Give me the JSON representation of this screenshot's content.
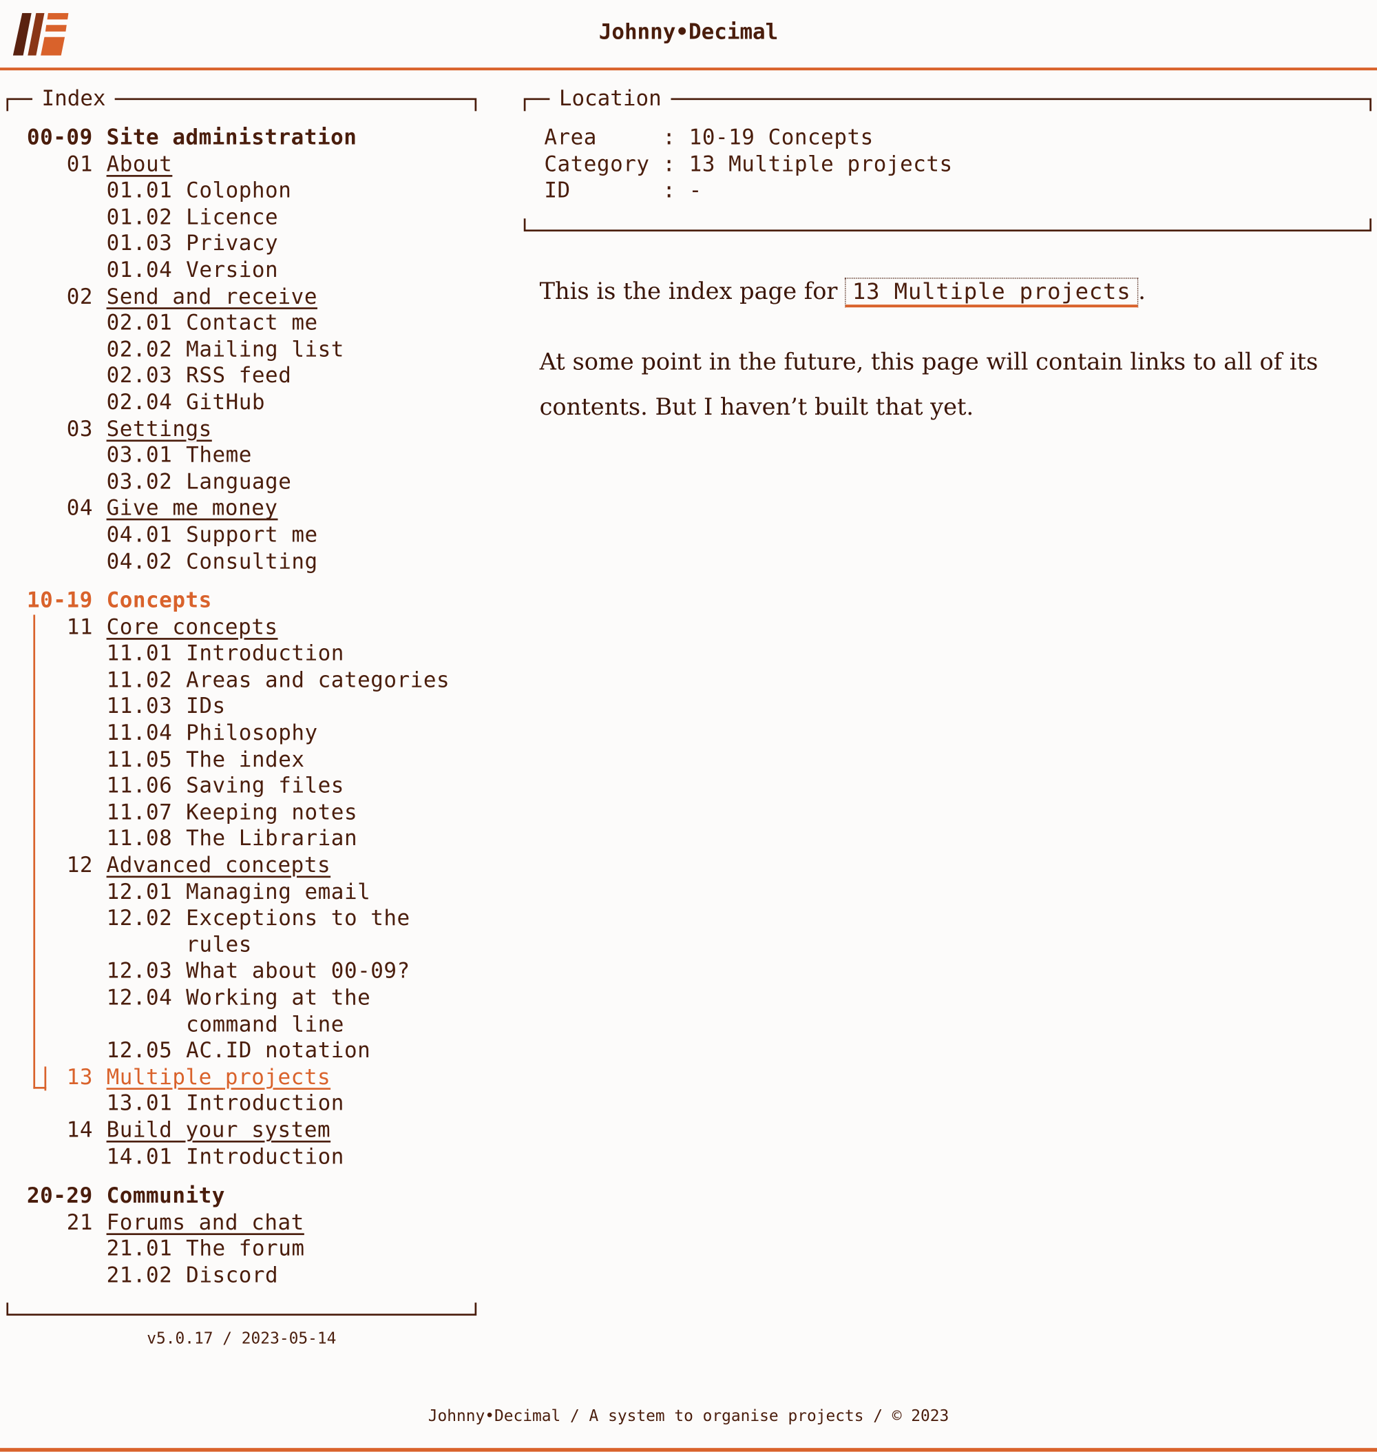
{
  "site_title": "Johnny•Decimal",
  "colors": {
    "accent": "#d9622b",
    "text": "#4a1d0c",
    "background": "#fcfbfa"
  },
  "index": {
    "legend": "Index",
    "areas": [
      {
        "num": "00-09",
        "label": "Site administration",
        "current": false,
        "categories": [
          {
            "num": "01",
            "label": "About",
            "ids": [
              {
                "num": "01.01",
                "label": "Colophon"
              },
              {
                "num": "01.02",
                "label": "Licence"
              },
              {
                "num": "01.03",
                "label": "Privacy"
              },
              {
                "num": "01.04",
                "label": "Version"
              }
            ]
          },
          {
            "num": "02",
            "label": "Send and receive",
            "ids": [
              {
                "num": "02.01",
                "label": "Contact me"
              },
              {
                "num": "02.02",
                "label": "Mailing list"
              },
              {
                "num": "02.03",
                "label": "RSS feed"
              },
              {
                "num": "02.04",
                "label": "GitHub"
              }
            ]
          },
          {
            "num": "03",
            "label": "Settings",
            "ids": [
              {
                "num": "03.01",
                "label": "Theme"
              },
              {
                "num": "03.02",
                "label": "Language"
              }
            ]
          },
          {
            "num": "04",
            "label": "Give me money",
            "ids": [
              {
                "num": "04.01",
                "label": "Support me"
              },
              {
                "num": "04.02",
                "label": "Consulting"
              }
            ]
          }
        ]
      },
      {
        "num": "10-19",
        "label": "Concepts",
        "current": true,
        "categories": [
          {
            "num": "11",
            "label": "Core concepts",
            "ids": [
              {
                "num": "11.01",
                "label": "Introduction"
              },
              {
                "num": "11.02",
                "label": "Areas and categories"
              },
              {
                "num": "11.03",
                "label": "IDs"
              },
              {
                "num": "11.04",
                "label": "Philosophy"
              },
              {
                "num": "11.05",
                "label": "The index"
              },
              {
                "num": "11.06",
                "label": "Saving files"
              },
              {
                "num": "11.07",
                "label": "Keeping notes"
              },
              {
                "num": "11.08",
                "label": "The Librarian"
              }
            ]
          },
          {
            "num": "12",
            "label": "Advanced concepts",
            "ids": [
              {
                "num": "12.01",
                "label": "Managing email"
              },
              {
                "num": "12.02",
                "label": "Exceptions to the rules"
              },
              {
                "num": "12.03",
                "label": "What about 00-09?"
              },
              {
                "num": "12.04",
                "label": "Working at the command line"
              },
              {
                "num": "12.05",
                "label": "AC.ID notation"
              }
            ]
          },
          {
            "num": "13",
            "label": "Multiple projects",
            "current": true,
            "ids": [
              {
                "num": "13.01",
                "label": "Introduction"
              }
            ]
          },
          {
            "num": "14",
            "label": "Build your system",
            "ids": [
              {
                "num": "14.01",
                "label": "Introduction"
              }
            ]
          }
        ]
      },
      {
        "num": "20-29",
        "label": "Community",
        "current": false,
        "categories": [
          {
            "num": "21",
            "label": "Forums and chat",
            "ids": [
              {
                "num": "21.01",
                "label": "The forum"
              },
              {
                "num": "21.02",
                "label": "Discord"
              }
            ]
          }
        ]
      }
    ]
  },
  "location": {
    "legend": "Location",
    "rows": [
      {
        "key": "Area",
        "sep": ": ",
        "value": "10-19 Concepts"
      },
      {
        "key": "Category",
        "sep": ": ",
        "value": "13 Multiple projects"
      },
      {
        "key": "ID",
        "sep": ": ",
        "value": "-"
      }
    ]
  },
  "content": {
    "intro_before": "This is the index page for ",
    "intro_link": "13 Multiple projects",
    "intro_after": ".",
    "paragraph": "At some point in the future, this page will contain links to all of its contents. But I haven’t built that yet."
  },
  "version": "v5.0.17 / 2023-05-14",
  "footer": "Johnny•Decimal / A system to organise projects / © 2023"
}
